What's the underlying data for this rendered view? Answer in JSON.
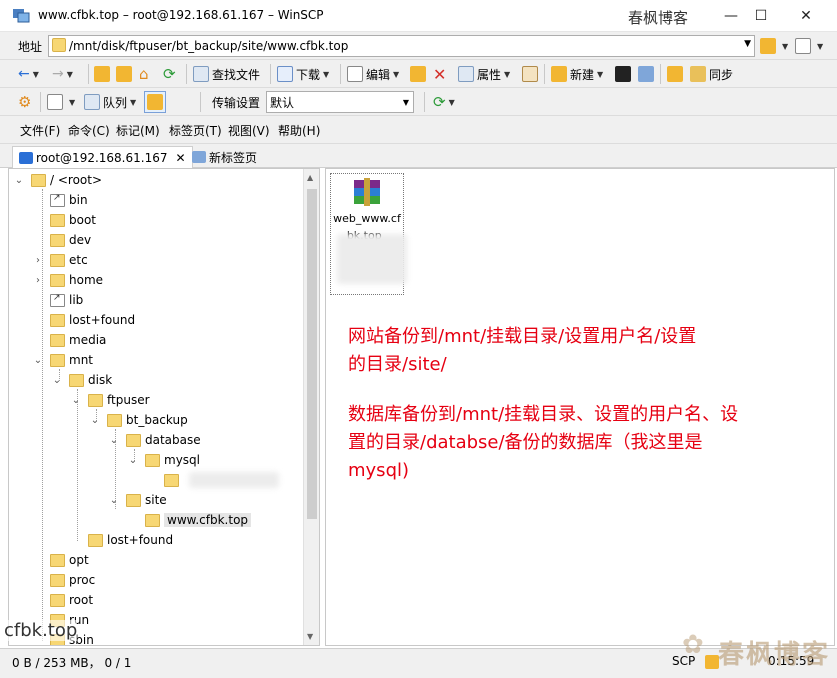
{
  "window": {
    "title": "www.cfbk.top – root@192.168.61.167 – WinSCP",
    "overlay_title": "春枫博客",
    "controls": {
      "minimize": "—",
      "maximize": "☐",
      "close": "✕"
    }
  },
  "address": {
    "label": "地址",
    "path": "/mnt/disk/ftpuser/bt_backup/site/www.cfbk.top"
  },
  "toolbar": {
    "find_files": "查找文件",
    "download": "下载",
    "edit": "编辑",
    "properties": "属性",
    "new": "新建",
    "sync": "同步"
  },
  "toolbar2": {
    "queue": "队列",
    "transfer_settings_label": "传输设置",
    "transfer_settings_value": "默认"
  },
  "menu": [
    "文件(F)",
    "命令(C)",
    "标记(M)",
    "标签页(T)",
    "视图(V)",
    "帮助(H)"
  ],
  "tabs": {
    "session": "root@192.168.61.167",
    "new_tab": "新标签页"
  },
  "tree": {
    "root": "/ <root>",
    "items": {
      "bin": "bin",
      "boot": "boot",
      "dev": "dev",
      "etc": "etc",
      "home": "home",
      "lib": "lib",
      "lost_found": "lost+found",
      "media": "media",
      "mnt": "mnt",
      "disk": "disk",
      "ftpuser": "ftpuser",
      "bt_backup": "bt_backup",
      "database": "database",
      "mysql": "mysql",
      "site": "site",
      "www": "www.cfbk.top",
      "lost_found2": "lost+found",
      "opt": "opt",
      "proc": "proc",
      "root": "root",
      "run": "run",
      "sbin": "sbin"
    }
  },
  "files": [
    {
      "name": "web_www.cfbk.top_",
      "type": "rar-archive"
    }
  ],
  "annotation": {
    "line1": "网站备份到/mnt/挂载目录/设置用户名/设置",
    "line2": "的目录/site/",
    "line3": "数据库备份到/mnt/挂载目录、设置的用户名、设",
    "line4": "置的目录/databse/备份的数据库（我这里是",
    "line5": "mysql)"
  },
  "status": {
    "size": "0 B / 253 MB， 0 / 1",
    "protocol": "SCP",
    "time": "0:15:59"
  },
  "watermark": {
    "domain": "cfbk.top",
    "logo": "春枫博客"
  },
  "colors": {
    "annotation": "#e60012",
    "folder": "#f7d774"
  }
}
